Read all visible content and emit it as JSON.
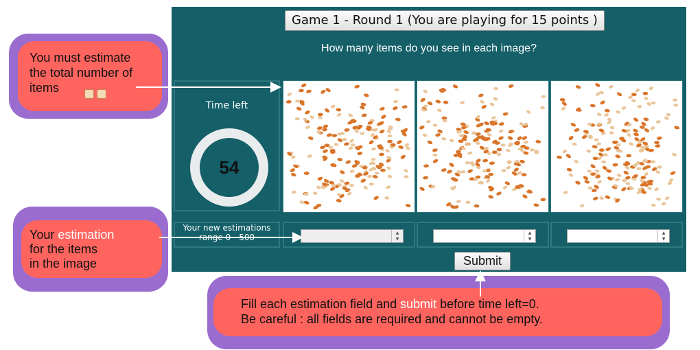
{
  "game": {
    "title": "Game 1 - Round 1 (You are playing for 15 points )",
    "question": "How many items do you see in each image?",
    "time_label": "Time left",
    "time_value": "54",
    "range_label_line1": "Your new estimations",
    "range_label_line2": "range 0 - 500",
    "inputs": [
      {
        "value": "",
        "placeholder": ""
      },
      {
        "value": "",
        "placeholder": ""
      },
      {
        "value": "",
        "placeholder": ""
      }
    ],
    "submit_label": "Submit"
  },
  "callouts": {
    "top_left_lines": [
      "You must estimate",
      "the total number of",
      "items"
    ],
    "mid_left_line1_pre": "Your ",
    "mid_left_line1_hl": "estimation",
    "mid_left_line2": "for the items",
    "mid_left_line3": "in the image",
    "bottom_line1_pre": "Fill each estimation field and ",
    "bottom_line1_hl": "submit",
    "bottom_line1_post": " before time left=0.",
    "bottom_line2": "Be careful : all fields are required and cannot be empty."
  },
  "colors": {
    "panel": "#145f68",
    "callout_border": "#9b6ccf",
    "callout_fill": "#ff645f",
    "item_dark": "#d9752a",
    "item_light": "#e9c59a"
  }
}
